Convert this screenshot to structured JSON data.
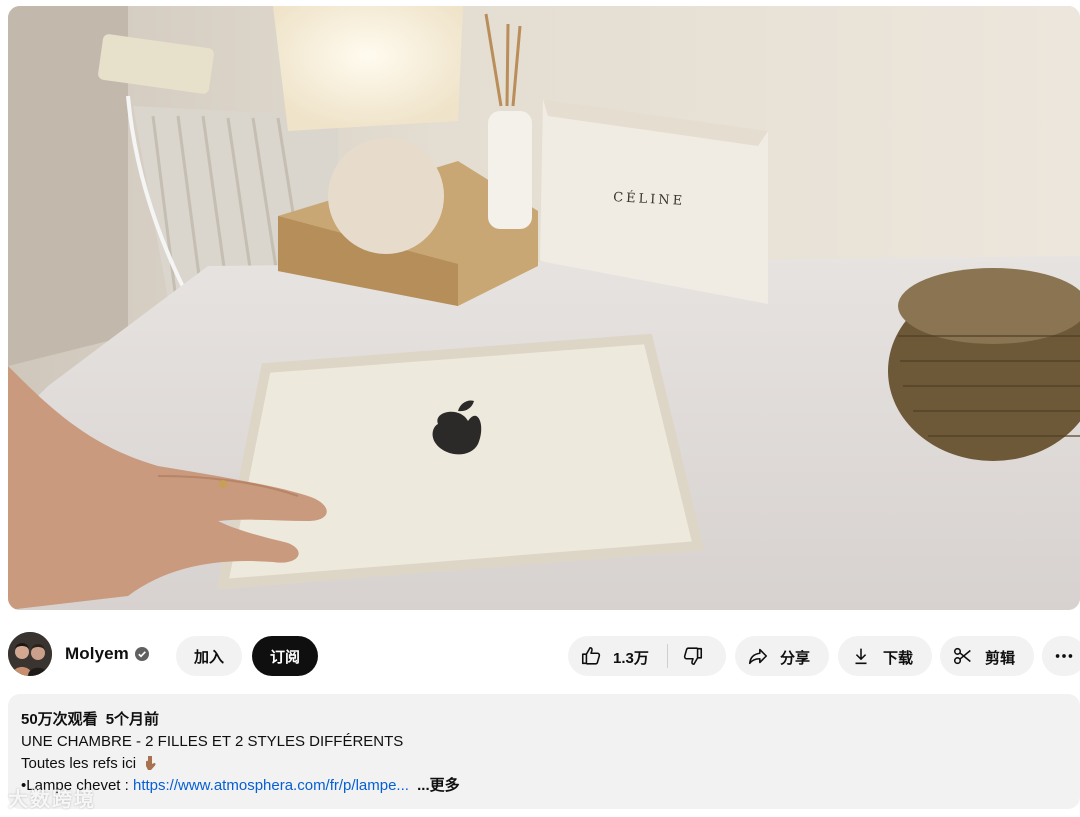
{
  "video": {
    "case_brand_text": "CÉLINE"
  },
  "channel": {
    "name": "Molyem",
    "join_label": "加入",
    "subscribe_label": "订阅"
  },
  "actions": {
    "like_count": "1.3万",
    "share_label": "分享",
    "download_label": "下载",
    "clip_label": "剪辑",
    "more_label": "…"
  },
  "description": {
    "views": "50万次观看",
    "time_ago": "5个月前",
    "line1": "UNE CHAMBRE - 2 FILLES ET 2 STYLES DIFFÉRENTS",
    "line2": "Toutes les refs ici",
    "line3_prefix": "•Lampe chevet : ",
    "line3_link": "https://www.atmosphera.com/fr/p/lampe...",
    "more_label": "...更多"
  },
  "watermark": "大数跨境",
  "icons": [
    "verified-icon",
    "like-icon",
    "dislike-icon",
    "share-icon",
    "download-icon",
    "scissors-icon",
    "more-horizontal-icon",
    "pointing-down-emoji"
  ],
  "colors": {
    "accent_link": "#065fd4",
    "subscribe_bg": "#0f0f0f",
    "pill_bg": "#f2f2f2"
  }
}
